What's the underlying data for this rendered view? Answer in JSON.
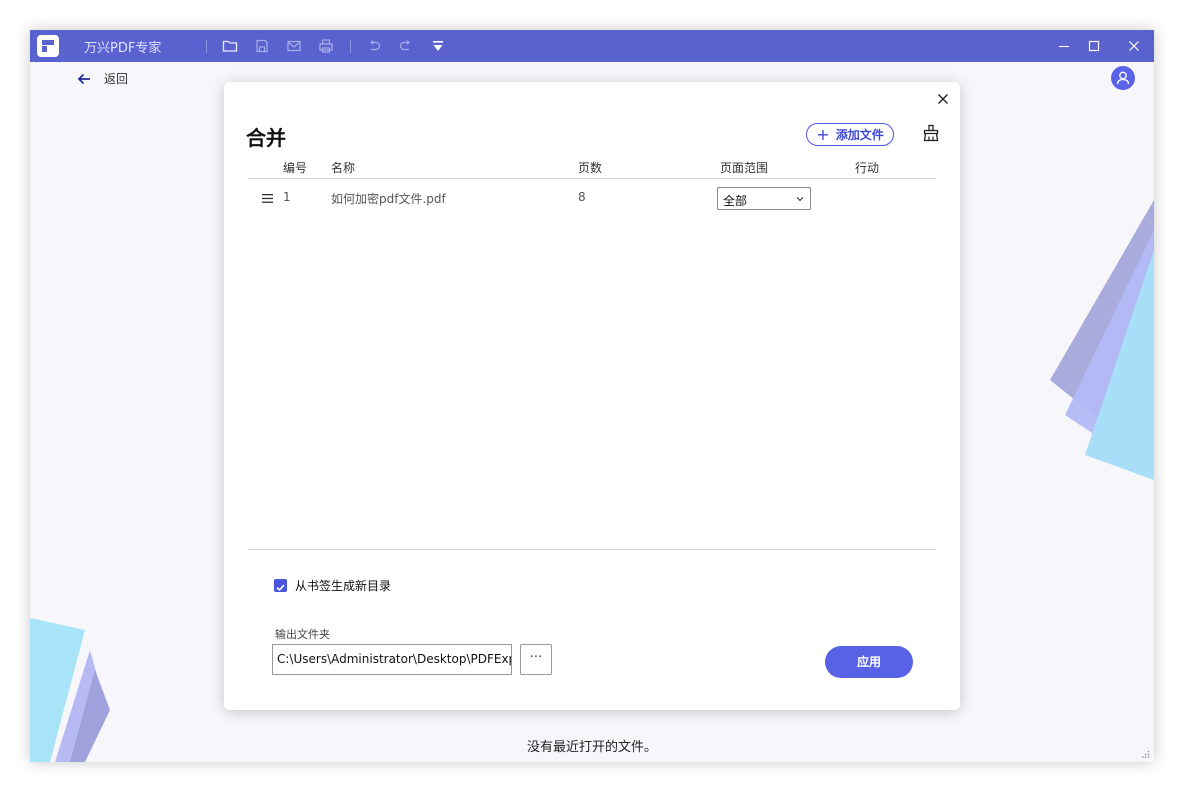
{
  "app": {
    "title": "万兴PDF专家",
    "toolbar_icons": [
      "folder-icon",
      "save-icon",
      "mail-icon",
      "print-icon",
      "undo-icon",
      "redo-icon",
      "quick-access-dropdown-icon"
    ],
    "window_controls": [
      "minimize-icon",
      "maximize-icon",
      "close-icon"
    ],
    "titlebar_color": "#5a62d0"
  },
  "nav": {
    "back_label": "返回"
  },
  "home": {
    "empty_message": "没有最近打开的文件。"
  },
  "merge_dialog": {
    "title": "合并",
    "add_file_label": "添加文件",
    "columns": {
      "number": "编号",
      "name": "名称",
      "pages": "页数",
      "page_range": "页面范围",
      "action": "行动"
    },
    "files": [
      {
        "number": "1",
        "name": "如何加密pdf文件.pdf",
        "pages": "8",
        "page_range": "全部"
      }
    ],
    "bookmark_toc_label": "从书签生成新目录",
    "bookmark_toc_checked": true,
    "output_folder_label": "输出文件夹",
    "output_folder_value": "C:\\Users\\Administrator\\Desktop\\PDFExp",
    "browse_label": "···",
    "apply_label": "应用",
    "accent_color": "#5762e6"
  }
}
